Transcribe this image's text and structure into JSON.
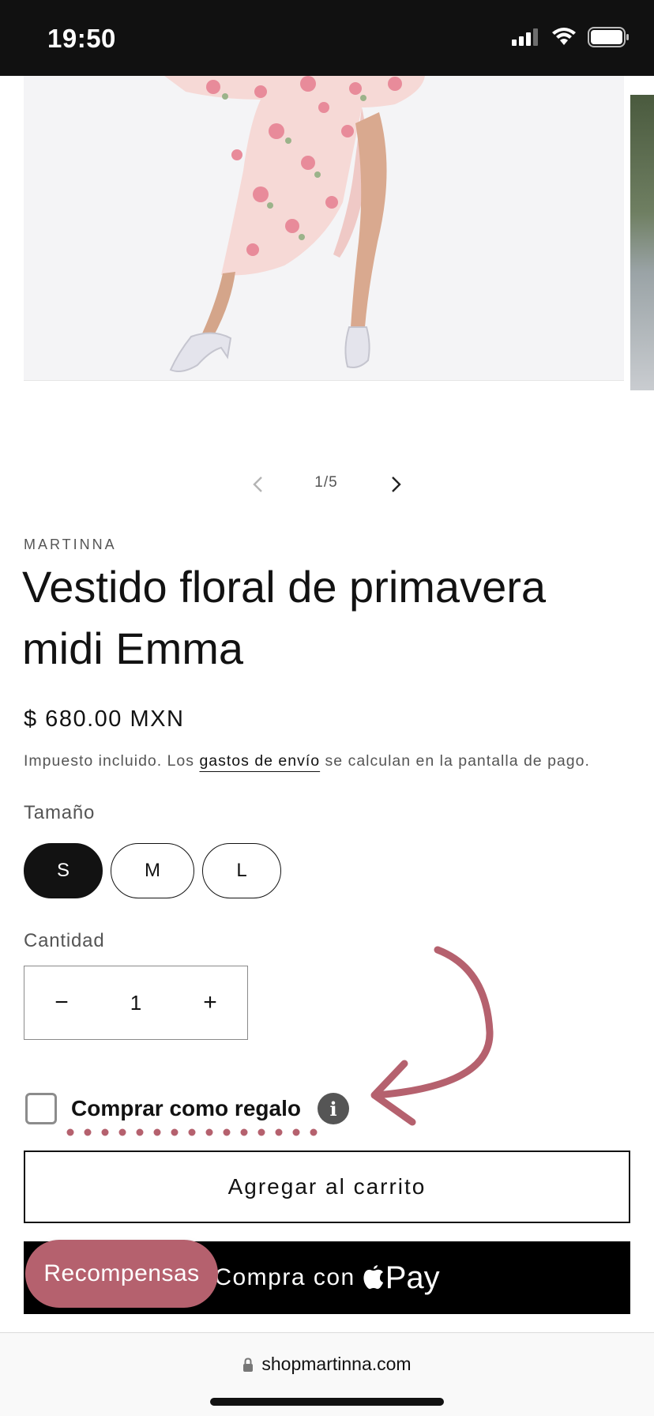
{
  "status_bar": {
    "time": "19:50"
  },
  "gallery": {
    "pagination": "1/5"
  },
  "product": {
    "vendor": "MARTINNA",
    "title": "Vestido floral de primavera midi Emma",
    "price": "$ 680.00 MXN",
    "tax_note_prefix": "Impuesto incluido. Los ",
    "tax_note_link": "gastos de envío",
    "tax_note_suffix": " se calculan en la pantalla de pago."
  },
  "size": {
    "label": "Tamaño",
    "options": [
      "S",
      "M",
      "L"
    ],
    "selected": "S"
  },
  "quantity": {
    "label": "Cantidad",
    "value": "1",
    "decrease": "−",
    "increase": "+"
  },
  "gift": {
    "label": "Comprar como regalo",
    "checked": false,
    "info": "i"
  },
  "actions": {
    "add_to_cart": "Agregar al carrito",
    "apple_pay_prefix": "Compra con",
    "apple_pay_brand": "Pay"
  },
  "rewards": {
    "label": "Recompensas"
  },
  "browser": {
    "url": "shopmartinna.com"
  },
  "colors": {
    "accent": "#b5616e",
    "text": "#121212",
    "muted": "#555555"
  },
  "icons": [
    "signal-icon",
    "wifi-icon",
    "battery-icon",
    "chevron-left-icon",
    "chevron-right-icon",
    "info-icon",
    "apple-logo-icon",
    "lock-icon",
    "curved-arrow-icon"
  ]
}
